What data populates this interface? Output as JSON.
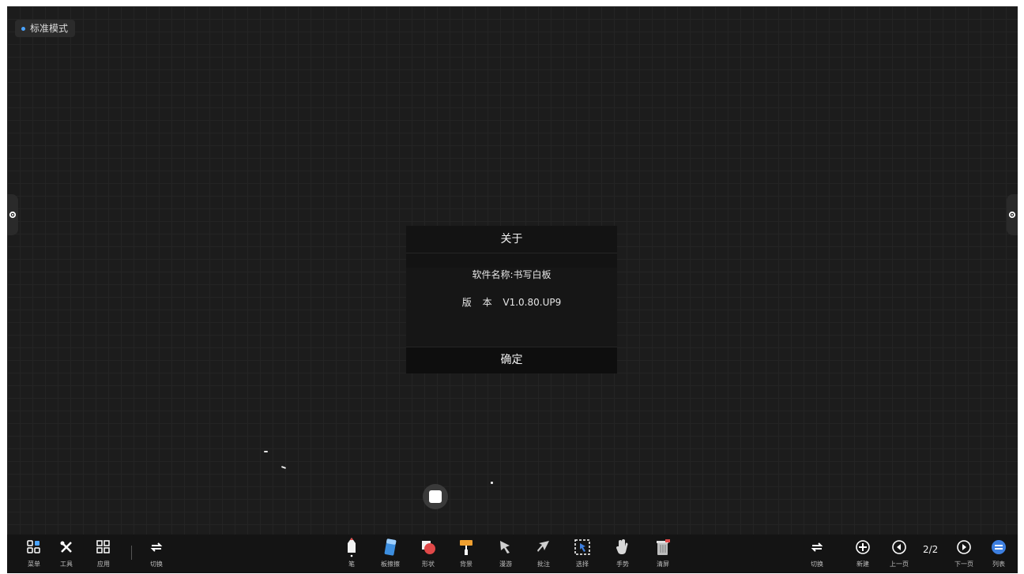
{
  "mode": {
    "label": "标准模式"
  },
  "dialog": {
    "title": "关于",
    "name_line": "软件名称:书写白板",
    "version_line": "版 本 V1.0.80.UP9",
    "confirm_label": "确定"
  },
  "toolbar": {
    "left": [
      {
        "icon": "menu-grid-icon",
        "label": "菜单"
      },
      {
        "icon": "tools-icon",
        "label": "工具"
      },
      {
        "icon": "apps-grid-icon",
        "label": "应用"
      },
      {
        "icon": "switch-icon",
        "label": "切换"
      }
    ],
    "center": [
      {
        "icon": "pen-icon",
        "label": "笔"
      },
      {
        "icon": "eraser-icon",
        "label": "板擦擦"
      },
      {
        "icon": "shape-icon",
        "label": "形状"
      },
      {
        "icon": "fill-roller-icon",
        "label": "背景"
      },
      {
        "icon": "select-arrow-icon",
        "label": "漫游"
      },
      {
        "icon": "pointer-arrow-icon",
        "label": "批注"
      },
      {
        "icon": "box-select-icon",
        "label": "选择"
      },
      {
        "icon": "hand-icon",
        "label": "手势"
      },
      {
        "icon": "trash-icon",
        "label": "清屏"
      }
    ],
    "right": {
      "switch": {
        "icon": "switch-icon",
        "label": "切换"
      },
      "add": {
        "icon": "add-page-icon",
        "label": "新建"
      },
      "prev": {
        "icon": "prev-page-icon",
        "label": "上一页"
      },
      "page_indicator": "2/2",
      "next": {
        "icon": "next-page-icon",
        "label": "下一页"
      },
      "list": {
        "icon": "page-list-icon",
        "label": "列表"
      }
    }
  },
  "colors": {
    "accent": "#4aa3ff",
    "board": "#1c1c1c",
    "toolbar": "#141414"
  }
}
